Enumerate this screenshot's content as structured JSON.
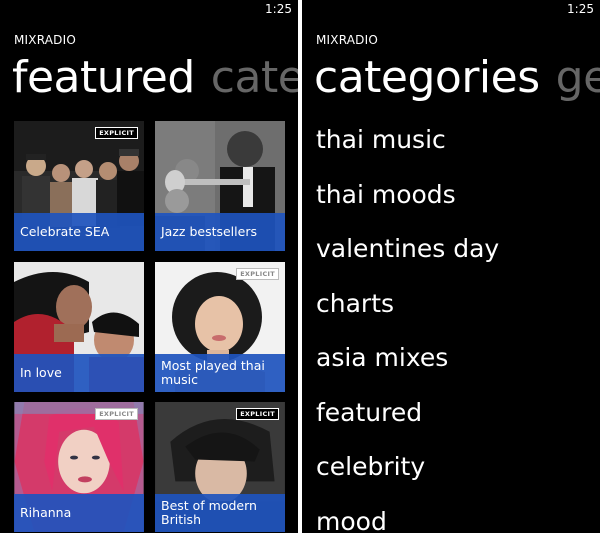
{
  "status": {
    "time": "1:25"
  },
  "left_screen": {
    "app_title": "MIXRADIO",
    "pivots": [
      "featured",
      "categories"
    ],
    "tiles": [
      {
        "label": "Celebrate SEA",
        "explicit": true,
        "badge_style": "dark"
      },
      {
        "label": "Jazz bestsellers",
        "explicit": false
      },
      {
        "label": "In love",
        "explicit": false
      },
      {
        "label": "Most played thai music",
        "explicit": true,
        "badge_style": "light"
      },
      {
        "label": "Rihanna",
        "explicit": true,
        "badge_style": "light"
      },
      {
        "label": "Best of modern British",
        "explicit": true,
        "badge_style": "dark"
      }
    ],
    "badge_text": "EXPLICIT"
  },
  "right_screen": {
    "app_title": "MIXRADIO",
    "pivots": [
      "categories",
      "genres"
    ],
    "categories": [
      "thai music",
      "thai moods",
      "valentines day",
      "charts",
      "asia mixes",
      "featured",
      "celebrity",
      "mood"
    ]
  }
}
